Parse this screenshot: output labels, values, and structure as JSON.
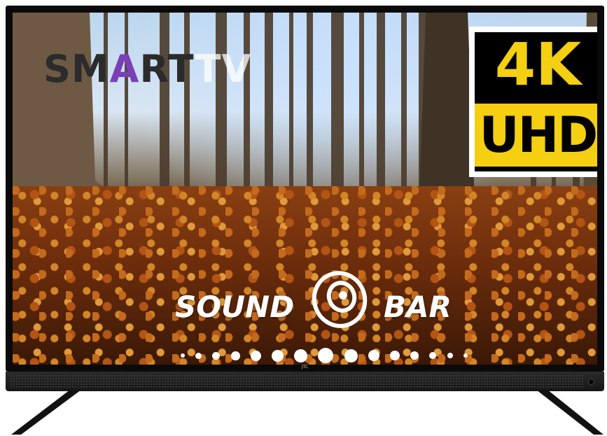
{
  "product": {
    "brand_mark": "JTC"
  },
  "logos": {
    "smart_tv": {
      "part1": "SM",
      "a": "A",
      "part2": "RT",
      "part3": "TV"
    },
    "resolution_badge": {
      "line1": "4K",
      "line2": "UHD"
    },
    "soundbar": {
      "word1": "SOUND",
      "word2": "BAR"
    }
  },
  "colors": {
    "badge_yellow": "#f4cf12",
    "badge_black": "#000000",
    "bezel": "#0a0a0a",
    "leaves_orange": "#c46a1c"
  },
  "icons": {
    "speaker": "speaker-icon"
  }
}
